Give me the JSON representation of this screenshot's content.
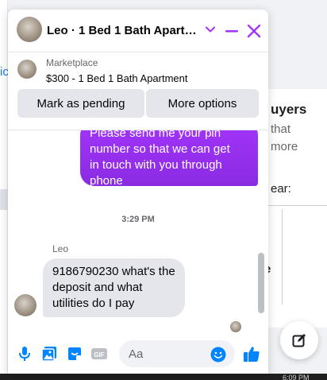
{
  "background": {
    "left_fragment": "ic",
    "card_heading": "uyers",
    "card_line1": "that",
    "card_line2": "more",
    "card_line3": "ear:",
    "card_fragment": "e",
    "taskbar_time": "6:09 PM"
  },
  "chat": {
    "title": "Leo · 1 Bed 1 Bath Apartme...",
    "listing": {
      "source": "Marketplace",
      "title": "$300 - 1 Bed 1 Bath Apartment",
      "primary_action": "Mark as pending",
      "secondary_action": "More options"
    },
    "messages": {
      "outgoing_lines": [
        "Please send me your pin",
        "number so that we can get",
        "in touch with you through",
        "phone"
      ],
      "timestamp": "3:29 PM",
      "sender_name": "Leo",
      "incoming_lines": [
        "9186790230 what's the",
        "deposit and what",
        "utilities do I pay"
      ]
    },
    "composer": {
      "placeholder": "Aa",
      "gif_label": "GIF"
    }
  },
  "colors": {
    "accent": "#a334fa",
    "icon_blue": "#0084ff",
    "bubble_incoming": "#e4e6eb"
  }
}
